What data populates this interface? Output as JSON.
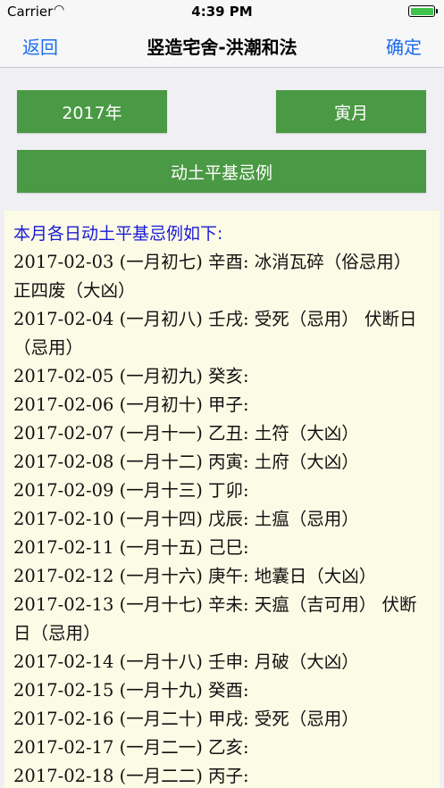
{
  "status_bar": {
    "carrier": "Carrier",
    "time": "4:39 PM"
  },
  "nav": {
    "back_label": "返回",
    "title": "竖造宅舍-洪潮和法",
    "confirm_label": "确定"
  },
  "buttons": {
    "year": "2017年",
    "month": "寅月",
    "type": "动土平基忌例"
  },
  "content": {
    "heading": "本月各日动土平基忌例如下:",
    "entries": [
      "2017-02-03 (一月初七) 辛酉: 冰消瓦碎（俗忌用） 正四废（大凶）",
      "2017-02-04 (一月初八) 壬戌: 受死（忌用） 伏断日（忌用）",
      "2017-02-05 (一月初九) 癸亥:",
      "2017-02-06 (一月初十) 甲子:",
      "2017-02-07 (一月十一) 乙丑: 土符（大凶）",
      "2017-02-08 (一月十二) 丙寅: 土府（大凶）",
      "2017-02-09 (一月十三) 丁卯:",
      "2017-02-10 (一月十四) 戊辰: 土瘟（忌用）",
      "2017-02-11 (一月十五) 己巳:",
      "2017-02-12 (一月十六) 庚午: 地囊日（大凶）",
      "2017-02-13 (一月十七) 辛未: 天瘟（吉可用） 伏断日（忌用）",
      "2017-02-14 (一月十八) 壬申: 月破（大凶）",
      "2017-02-15 (一月十九) 癸酉:",
      "2017-02-16 (一月二十) 甲戌: 受死（忌用）",
      "2017-02-17 (一月二一) 乙亥:",
      "2017-02-18 (一月二二) 丙子:"
    ]
  }
}
